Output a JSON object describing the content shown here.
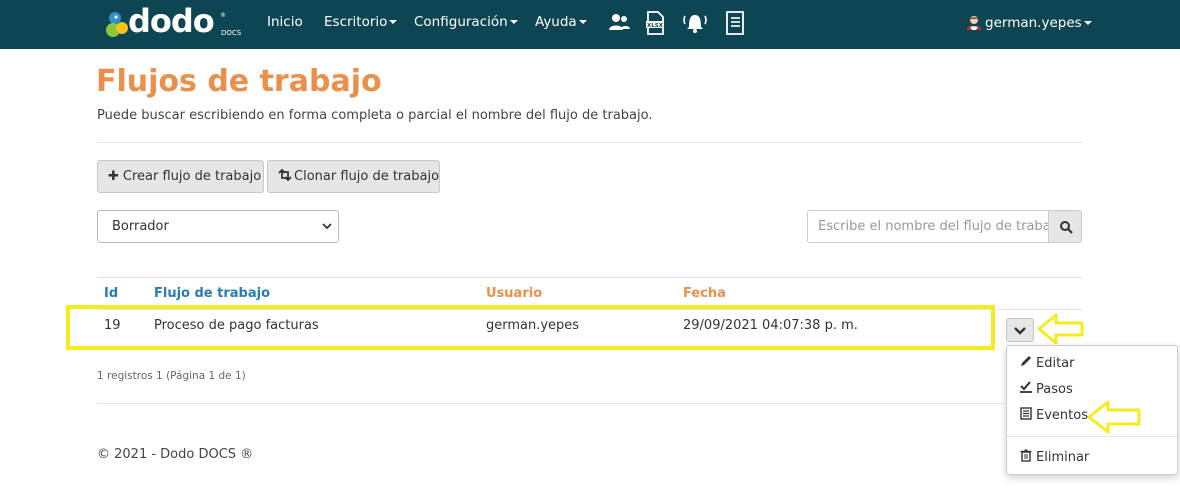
{
  "brand": {
    "name": "dodo",
    "sub": "DOCS",
    "reg": "®"
  },
  "nav": {
    "items": [
      {
        "label": "Inicio"
      },
      {
        "label": "Escritorio"
      },
      {
        "label": "Configuración"
      },
      {
        "label": "Ayuda"
      }
    ],
    "icons": [
      "users-icon",
      "xlsx-file-icon",
      "bell-icon",
      "document-list-icon"
    ],
    "user": "german.yepes"
  },
  "page": {
    "title": "Flujos de trabajo",
    "subtitle": "Puede buscar escribiendo en forma completa o parcial el nombre del flujo de trabajo."
  },
  "toolbar": {
    "create_label": "Crear flujo de trabajo",
    "clone_label": "Clonar flujo de trabajo"
  },
  "filter": {
    "selected": "Borrador",
    "search_placeholder": "Escribe el nombre del flujo de trabajo"
  },
  "table": {
    "headers": {
      "id": "Id",
      "name": "Flujo de trabajo",
      "user": "Usuario",
      "date": "Fecha"
    },
    "rows": [
      {
        "id": "19",
        "name": "Proceso de pago facturas",
        "user": "german.yepes",
        "date": "29/09/2021 04:07:38 p. m."
      }
    ]
  },
  "actions_menu": {
    "items": [
      {
        "label": "Editar",
        "icon": "pencil-icon"
      },
      {
        "label": "Pasos",
        "icon": "checkmark-icon"
      },
      {
        "label": "Eventos",
        "icon": "list-icon"
      },
      {
        "label": "Eliminar",
        "icon": "trash-icon"
      }
    ]
  },
  "pagination": {
    "records": "1 registros 1 (Página 1 de 1)"
  },
  "footer": {
    "text": "© 2021 - Dodo DOCS ®"
  },
  "colors": {
    "navbar": "#0d4553",
    "title": "#e8904c",
    "header_id": "#2a7ab5",
    "header_other": "#e8904c",
    "highlight": "#f5ec1e"
  }
}
